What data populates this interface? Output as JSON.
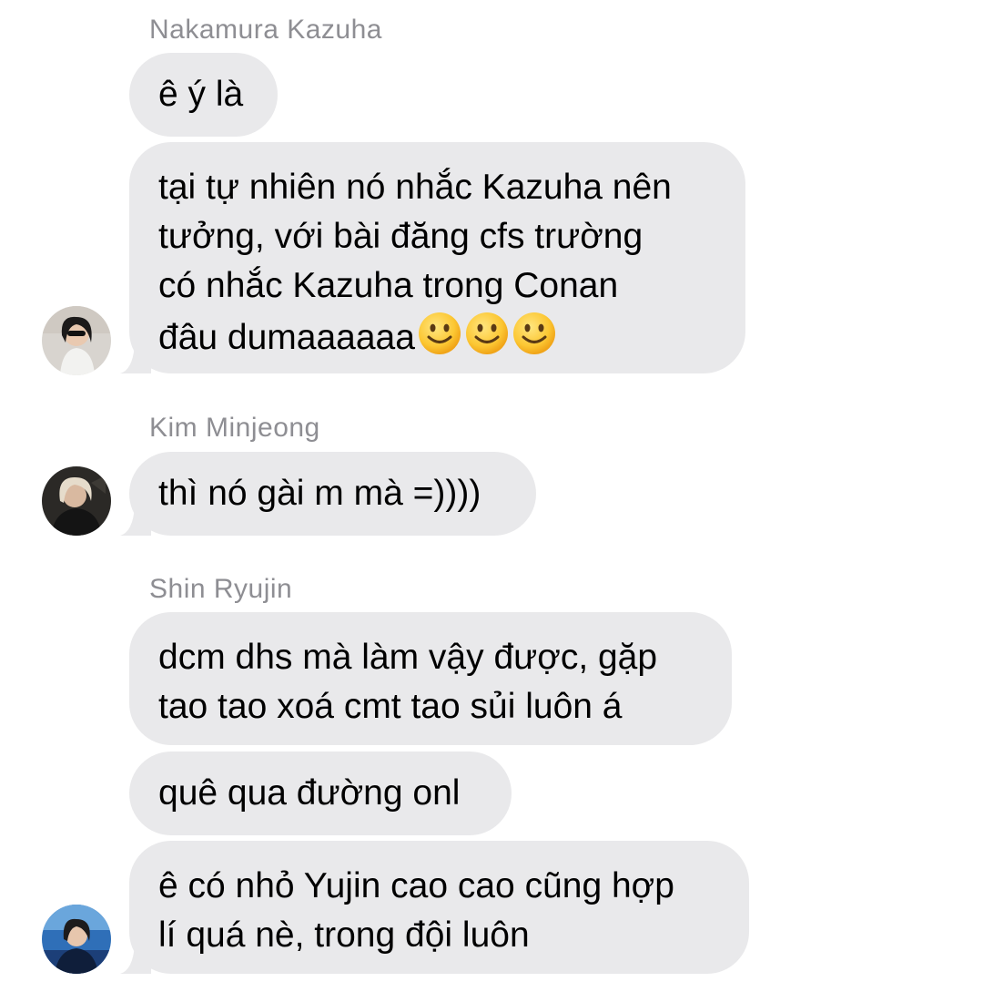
{
  "messages": [
    {
      "sender": "Nakamura Kazuha",
      "bubbles": [
        {
          "lines": [
            "ê ý là"
          ]
        },
        {
          "lines": [
            "tại tự nhiên nó nhắc Kazuha nên",
            "tưởng, với bài đăng cfs trường",
            "có nhắc Kazuha trong Conan",
            "đâu dumaaaaaa"
          ],
          "emoji": [
            "slightly-smiling-face",
            "slightly-smiling-face",
            "slightly-smiling-face"
          ]
        }
      ],
      "avatar_icon": "kazuha-avatar"
    },
    {
      "sender": "Kim Minjeong",
      "bubbles": [
        {
          "lines": [
            "thì nó gài m mà =))))"
          ]
        }
      ],
      "avatar_icon": "minjeong-avatar"
    },
    {
      "sender": "Shin Ryujin",
      "bubbles": [
        {
          "lines": [
            "dcm dhs mà làm vậy được, gặp",
            "tao tao xoá cmt tao sủi luôn á"
          ]
        },
        {
          "lines": [
            "quê qua đường onl"
          ]
        },
        {
          "lines": [
            "ê có nhỏ Yujin cao cao cũng hợp",
            "lí quá nè, trong đội luôn"
          ]
        }
      ],
      "avatar_icon": "ryujin-avatar"
    }
  ],
  "colors": {
    "bubble_bg": "#e9e9eb",
    "sender_name": "#8e8e93",
    "text": "#000000",
    "background": "#ffffff"
  }
}
